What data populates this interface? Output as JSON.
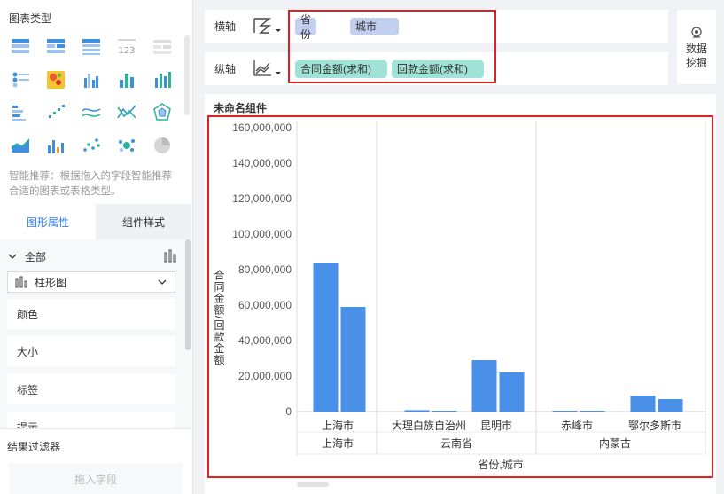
{
  "left_panel": {
    "title": "图表类型",
    "recommend_text": "智能推荐：根据拖入的字段智能推荐合适的图表或表格类型。",
    "tabs": [
      {
        "label": "图形属性",
        "active": true
      },
      {
        "label": "组件样式",
        "active": false
      }
    ],
    "all_label": "全部",
    "chart_type_value": "柱形图",
    "props": [
      "颜色",
      "大小",
      "标签",
      "提示"
    ],
    "filter_title": "结果过滤器",
    "filter_placeholder": "拖入字段",
    "chart_icons": [
      "cross-table-icon",
      "grouped-table-icon",
      "detail-table-icon",
      "kpi-number-icon",
      "disabled-table-icon",
      "point-map-icon",
      "heatmap-icon",
      "grouped-bar-icon",
      "bar-chart-icon",
      "multi-bar-icon",
      "stacked-bar-icon",
      "scatter-step-icon",
      "line-chart-icon",
      "multi-line-icon",
      "radar-icon",
      "area-chart-icon",
      "combo-chart-icon",
      "scatter-icon",
      "bubble-icon",
      "pie-chart-disabled-icon"
    ]
  },
  "axes": {
    "x_label": "横轴",
    "y_label": "纵轴",
    "x_fields": [
      "省份",
      "城市"
    ],
    "y_fields": [
      "合同金额(求和)",
      "回款金额(求和)"
    ]
  },
  "mining": {
    "line1": "数据",
    "line2": "挖掘"
  },
  "widget": {
    "title": "未命名组件"
  },
  "colors": {
    "bar": "#4a90e8",
    "accent": "#2f7cf6",
    "dim_pill": "#c3cfee",
    "measure_pill": "#9fe3d6",
    "highlight": "#e02020"
  },
  "chart_data": {
    "type": "bar",
    "ylabel": "合同金额/回款金额",
    "xlabel": "省份,城市",
    "ylim": [
      0,
      160000000
    ],
    "y_ticks": [
      "0",
      "20,000,000",
      "40,000,000",
      "60,000,000",
      "80,000,000",
      "100,000,000",
      "120,000,000",
      "140,000,000",
      "160,000,000"
    ],
    "groups": [
      {
        "province": "上海市",
        "cities": [
          "上海市"
        ]
      },
      {
        "province": "云南省",
        "cities": [
          "大理白族自治州",
          "昆明市"
        ]
      },
      {
        "province": "内蒙古",
        "cities": [
          "赤峰市",
          "鄂尔多斯市"
        ]
      }
    ],
    "categories": [
      "上海市",
      "大理白族自治州",
      "昆明市",
      "赤峰市",
      "鄂尔多斯市"
    ],
    "series": [
      {
        "name": "合同金额(求和)",
        "values": [
          84000000,
          800000,
          29000000,
          500000,
          9000000
        ]
      },
      {
        "name": "回款金额(求和)",
        "values": [
          59000000,
          500000,
          22000000,
          300000,
          7000000
        ]
      }
    ]
  }
}
